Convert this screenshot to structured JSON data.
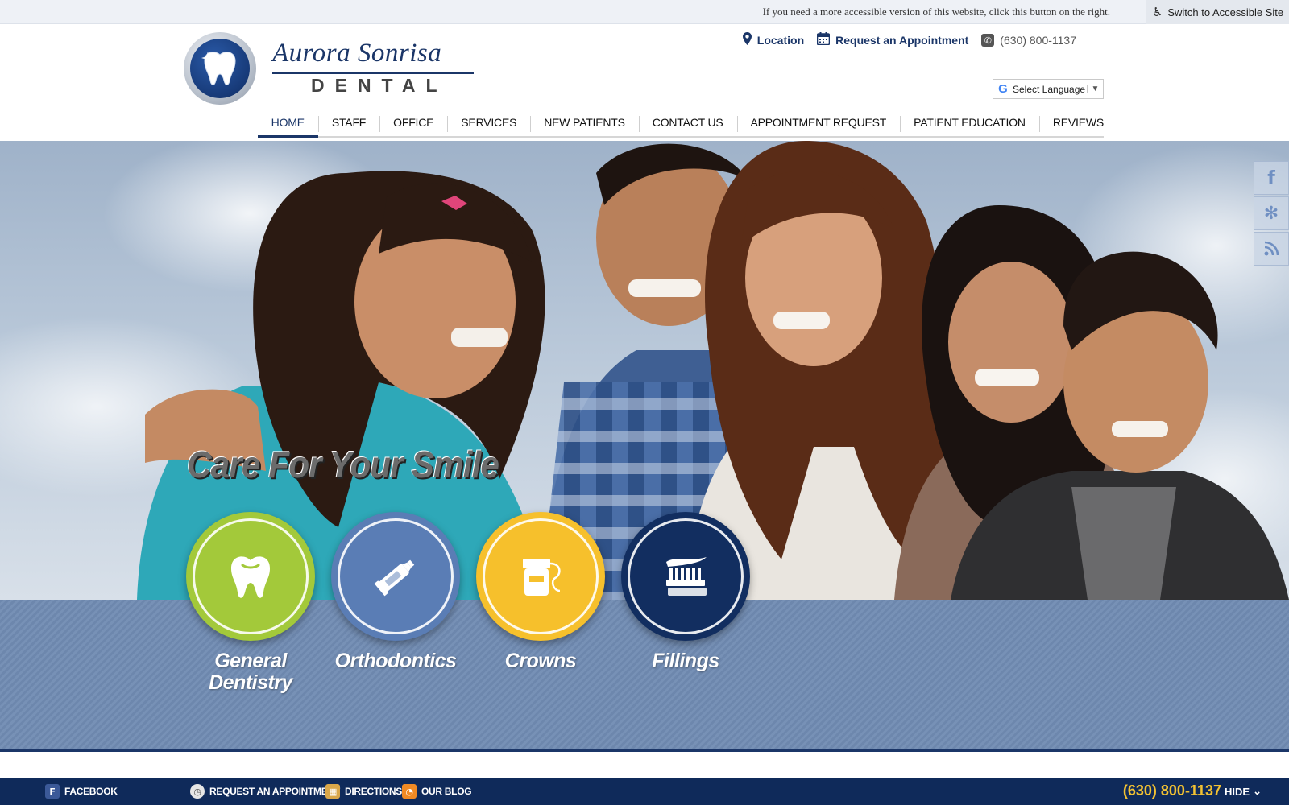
{
  "access": {
    "message": "If you need a more accessible version of this website, click this button on the right.",
    "button_label": "Switch to Accessible Site"
  },
  "logo": {
    "name": "Aurora Sonrisa",
    "subtitle": "DENTAL"
  },
  "contacts": {
    "location": "Location",
    "appointment": "Request an Appointment",
    "phone": "(630) 800-1137"
  },
  "language": {
    "label": "Select Language"
  },
  "nav": {
    "items": [
      "HOME",
      "STAFF",
      "OFFICE",
      "SERVICES",
      "NEW PATIENTS",
      "CONTACT US",
      "APPOINTMENT REQUEST",
      "PATIENT EDUCATION",
      "REVIEWS"
    ],
    "active": "HOME"
  },
  "hero": {
    "tagline": "Care For Your Smile"
  },
  "services": [
    {
      "label": "General Dentistry",
      "color": "#a3c93a",
      "icon": "tooth-icon"
    },
    {
      "label": "Orthodontics",
      "color": "#5a7db5",
      "icon": "toothpaste-icon"
    },
    {
      "label": "Crowns",
      "color": "#f6c02c",
      "icon": "floss-icon"
    },
    {
      "label": "Fillings",
      "color": "#122e60",
      "icon": "toothbrush-icon"
    }
  ],
  "footer": {
    "facebook": "FACEBOOK",
    "appointment": "REQUEST AN APPOINTMENT",
    "directions": "DIRECTIONS",
    "blog": "OUR BLOG",
    "phone": "(630) 800-1137",
    "hide": "HIDE"
  },
  "colors": {
    "brand_navy": "#1b3668",
    "footer_bg": "#0f2a5a",
    "band": "#7791b6",
    "phone_accent": "#f3c232"
  }
}
